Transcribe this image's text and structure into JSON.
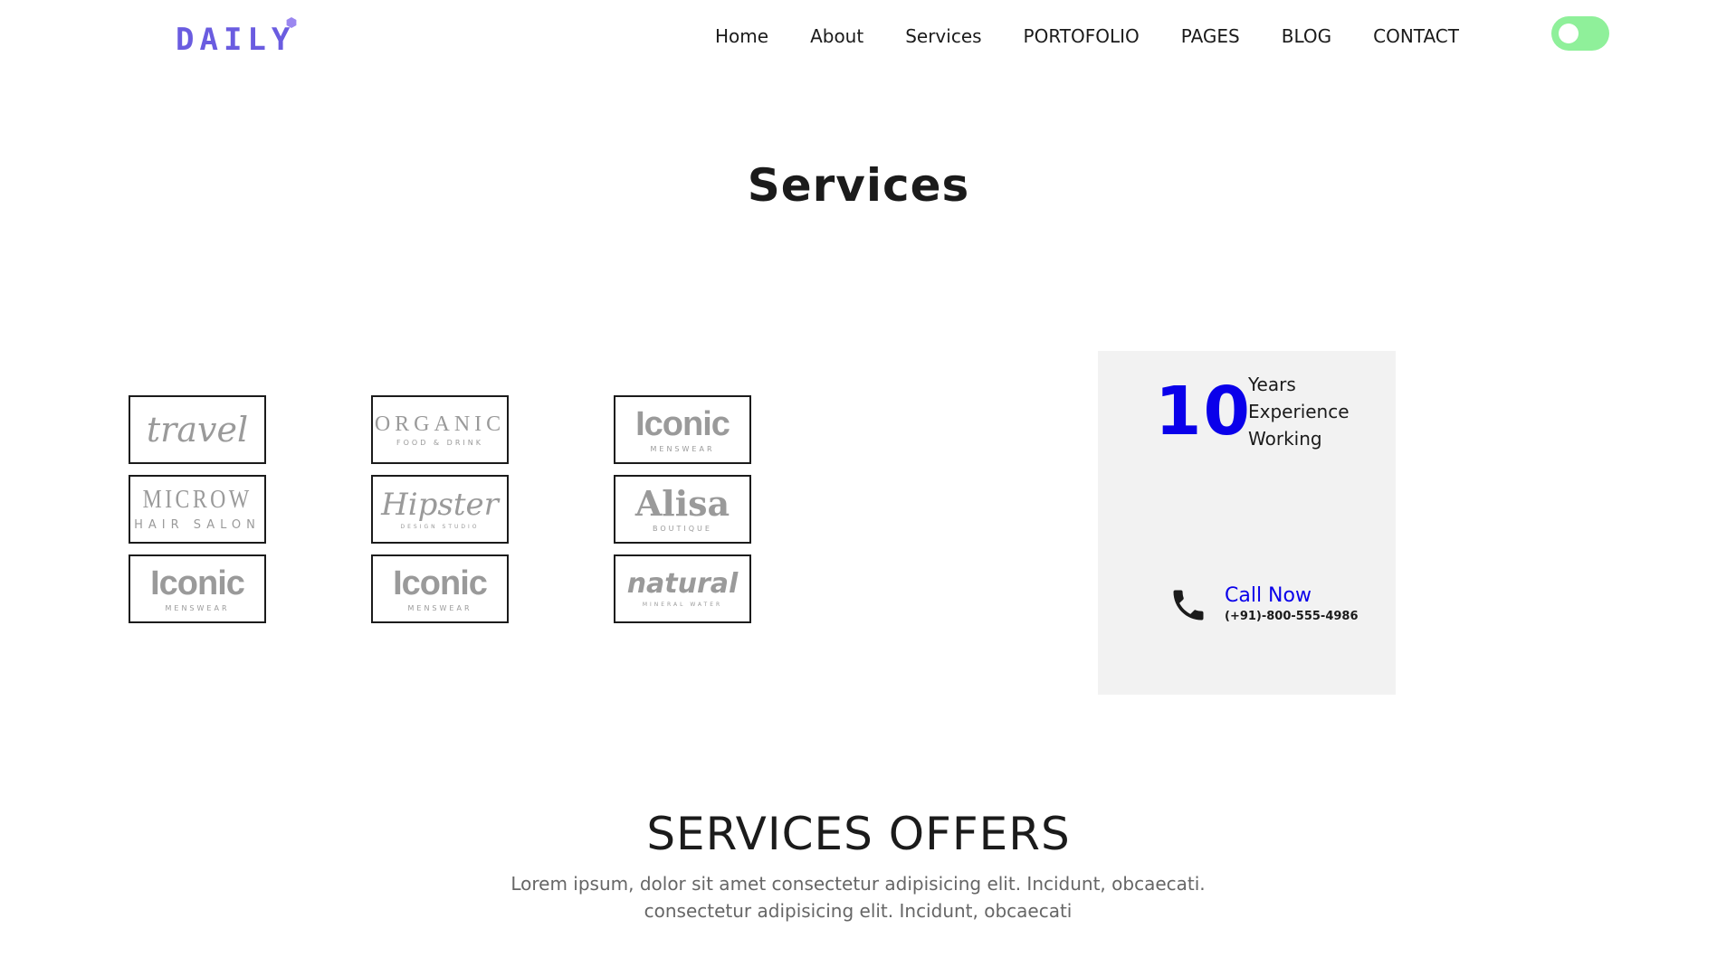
{
  "header": {
    "logo_text": "DAILY",
    "nav": [
      {
        "label": "Home"
      },
      {
        "label": "About"
      },
      {
        "label": "Services"
      },
      {
        "label": "PORTOFOLIO"
      },
      {
        "label": "PAGES"
      },
      {
        "label": "BLOG"
      },
      {
        "label": "CONTACT"
      }
    ],
    "theme_toggle": {
      "state": "off",
      "color": "#8ff09a"
    },
    "brand_color": "#6a5ce0"
  },
  "main": {
    "title": "Services",
    "brands": [
      {
        "main": "travel",
        "sub": "",
        "style": "script",
        "icon": "travel-logo"
      },
      {
        "main": "ORGANIC",
        "sub": "FOOD & DRINK",
        "style": "serif-spaced",
        "icon": "organic-logo"
      },
      {
        "main": "Iconic",
        "sub": "MENSWEAR",
        "style": "bold-sans",
        "icon": "iconic-logo"
      },
      {
        "main": "MICROW",
        "sub": "HAIR SALON",
        "style": "condensed",
        "icon": "microw-logo"
      },
      {
        "main": "Hipster",
        "sub": "DESIGN STUDIO",
        "style": "script",
        "icon": "hipster-logo"
      },
      {
        "main": "Alisa",
        "sub": "BOUTIQUE",
        "style": "bold-serif",
        "icon": "alisa-logo"
      },
      {
        "main": "Iconic",
        "sub": "MENSWEAR",
        "style": "bold-sans",
        "icon": "iconic-logo"
      },
      {
        "main": "Iconic",
        "sub": "MENSWEAR",
        "style": "bold-sans",
        "icon": "iconic-logo"
      },
      {
        "main": "natural",
        "sub": "MINERAL WATER",
        "style": "round",
        "icon": "natural-logo"
      }
    ],
    "experience": {
      "number": "10",
      "lines": [
        "Years",
        "Experience",
        "Working"
      ],
      "call_label": "Call Now",
      "phone": "(+91)-800-555-4986",
      "accent_color": "#0a00ea",
      "icon": "phone-icon"
    }
  },
  "offers": {
    "title": "SERVICES OFFERS",
    "desc_line1": "Lorem ipsum, dolor sit amet consectetur adipisicing elit. Incidunt, obcaecati.",
    "desc_line2": "consectetur adipisicing elit. Incidunt, obcaecati"
  }
}
